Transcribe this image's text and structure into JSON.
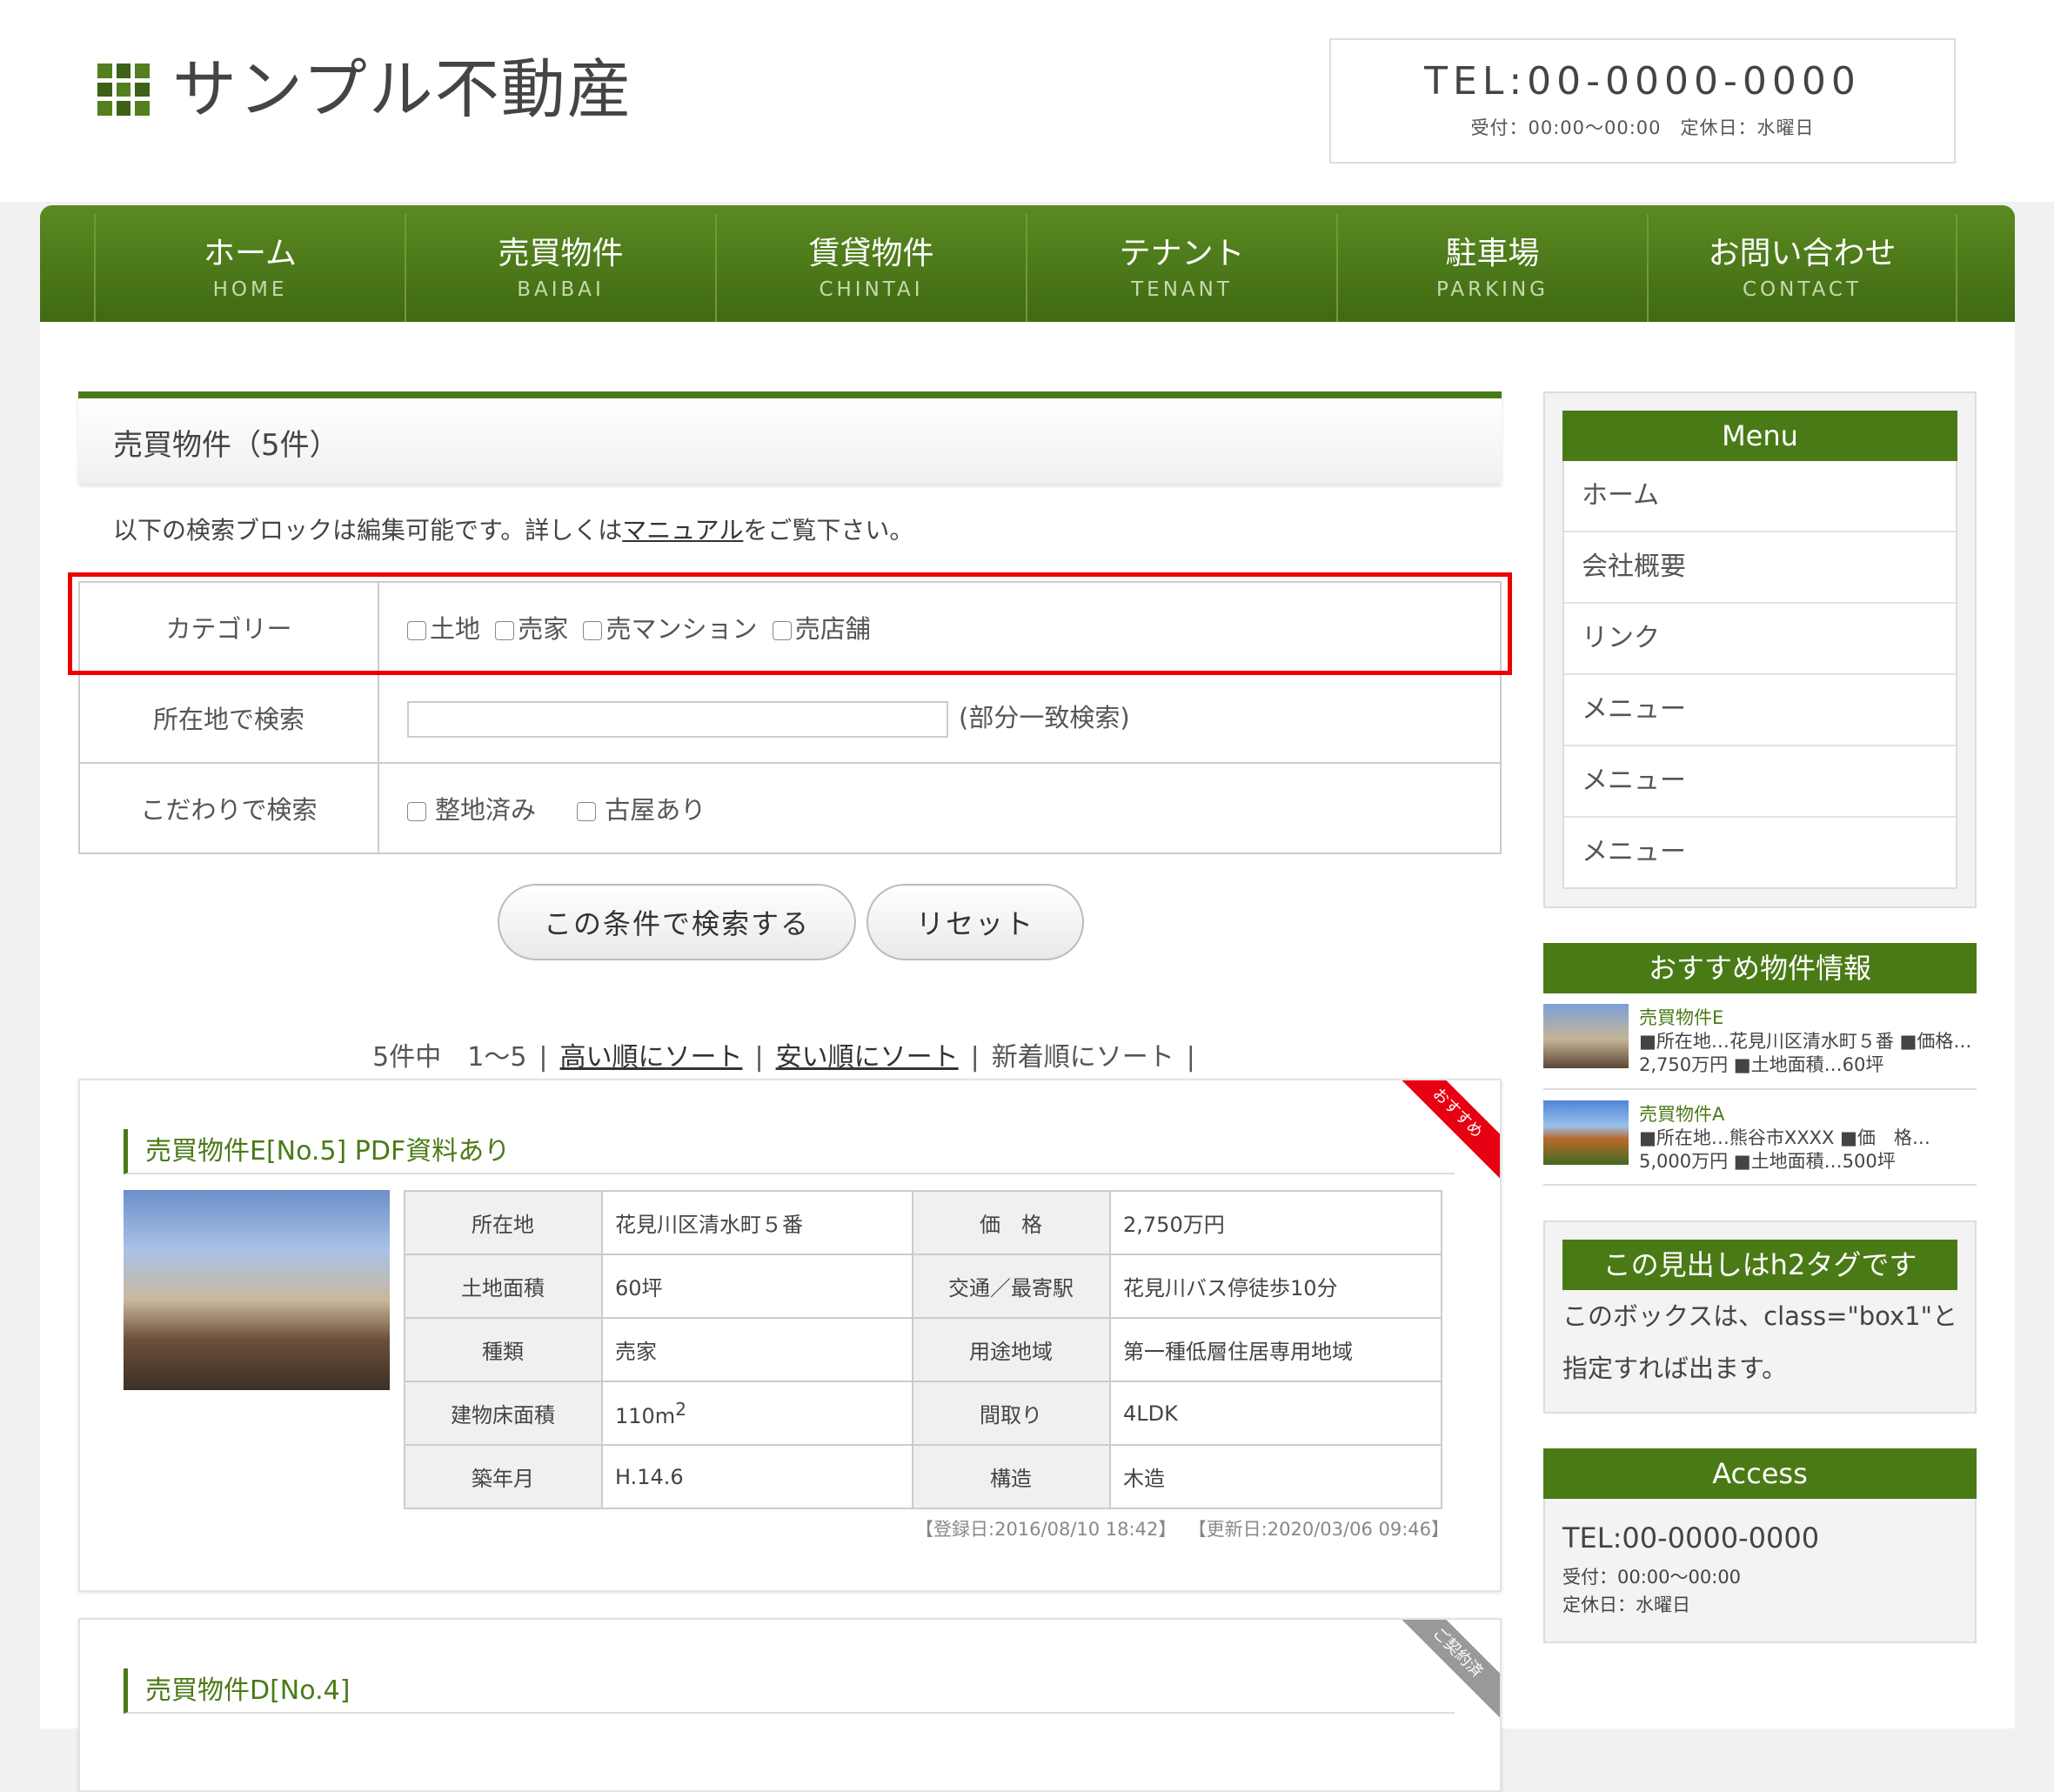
{
  "header": {
    "site_title": "サンプル不動産",
    "tel": "TEL:00-0000-0000",
    "hours": "受付：00:00〜00:00　定休日：水曜日"
  },
  "nav": [
    {
      "jp": "ホーム",
      "en": "HOME"
    },
    {
      "jp": "売買物件",
      "en": "BAIBAI"
    },
    {
      "jp": "賃貸物件",
      "en": "CHINTAI"
    },
    {
      "jp": "テナント",
      "en": "TENANT"
    },
    {
      "jp": "駐車場",
      "en": "PARKING"
    },
    {
      "jp": "お問い合わせ",
      "en": "CONTACT"
    }
  ],
  "main": {
    "page_title": "売買物件（5件）",
    "intro_before": "以下の検索ブロックは編集可能です。詳しくは",
    "intro_link": "マニュアル",
    "intro_after": "をご覧下さい。",
    "search": {
      "category_label": "カテゴリー",
      "categories": [
        "土地",
        "売家",
        "売マンション",
        "売店舗"
      ],
      "location_label": "所在地で検索",
      "location_value": "",
      "location_note": "(部分一致検索)",
      "feature_label": "こだわりで検索",
      "features": [
        "整地済み",
        "古屋あり"
      ],
      "search_button": "この条件で検索する",
      "reset_button": "リセット"
    },
    "sort": {
      "count": "5件中　1〜5",
      "high": "高い順にソート",
      "low": "安い順にソート",
      "newest": "新着順にソート"
    },
    "listings": [
      {
        "title": "売買物件E[No.5] PDF資料あり",
        "ribbon": "おすすめ",
        "details": [
          [
            "所在地",
            "花見川区清水町５番",
            "価　格",
            "2,750万円"
          ],
          [
            "土地面積",
            "60坪",
            "交通／最寄駅",
            "花見川バス停徒歩10分"
          ],
          [
            "種類",
            "売家",
            "用途地域",
            "第一種低層住居専用地域"
          ],
          [
            "建物床面積",
            "110m",
            "間取り",
            "4LDK"
          ],
          [
            "築年月",
            "H.14.6",
            "構造",
            "木造"
          ]
        ],
        "area_sup": "2",
        "registered": "【登録日:2016/08/10 18:42】",
        "updated": "【更新日:2020/03/06 09:46】"
      },
      {
        "title": "売買物件D[No.4]",
        "ribbon": "ご契約済"
      }
    ]
  },
  "sidebar": {
    "menu_title": "Menu",
    "menu_items": [
      "ホーム",
      "会社概要",
      "リンク",
      "メニュー",
      "メニュー",
      "メニュー"
    ],
    "rec_title": "おすすめ物件情報",
    "rec_items": [
      {
        "title": "売買物件E",
        "text": "■所在地…花見川区清水町５番 ■価格…2,750万円 ■土地面積…60坪"
      },
      {
        "title": "売買物件A",
        "text": "■所在地…熊谷市XXXX ■価　格…5,000万円 ■土地面積…500坪"
      }
    ],
    "box1_title": "この見出しはh2タグです",
    "box1_text": "このボックスは、class=\"box1\"と指定すれば出ます。",
    "access_title": "Access",
    "access_tel": "TEL:00-0000-0000",
    "access_hours": "受付：00:00〜00:00",
    "access_holiday": "定休日：水曜日"
  },
  "colors": {
    "brand_green": "#4a7a16",
    "highlight_red": "#e00000",
    "ribbon_red": "#e60012"
  }
}
